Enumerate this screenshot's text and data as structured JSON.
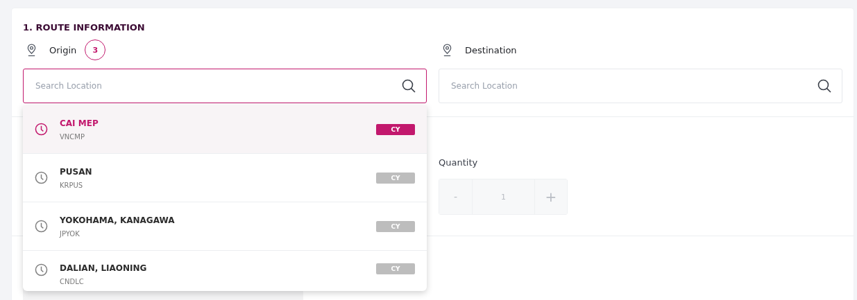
{
  "section_title": "1. ROUTE INFORMATION",
  "origin": {
    "label": "Origin",
    "step": "3",
    "placeholder": "Search Location",
    "focused": true
  },
  "destination": {
    "label": "Destination",
    "placeholder": "Search Location",
    "focused": false
  },
  "suggestions": [
    {
      "name": "CAI MEP",
      "code": "VNCMP",
      "tag": "CY",
      "selected": true
    },
    {
      "name": "PUSAN",
      "code": "KRPUS",
      "tag": "CY",
      "selected": false
    },
    {
      "name": "YOKOHAMA, KANAGAWA",
      "code": "JPYOK",
      "tag": "CY",
      "selected": false
    },
    {
      "name": "DALIAN, LIAONING",
      "code": "CNDLC",
      "tag": "CY",
      "selected": false
    }
  ],
  "quantity": {
    "label": "Quantity",
    "decrement": "-",
    "value": "1",
    "increment": "+"
  }
}
